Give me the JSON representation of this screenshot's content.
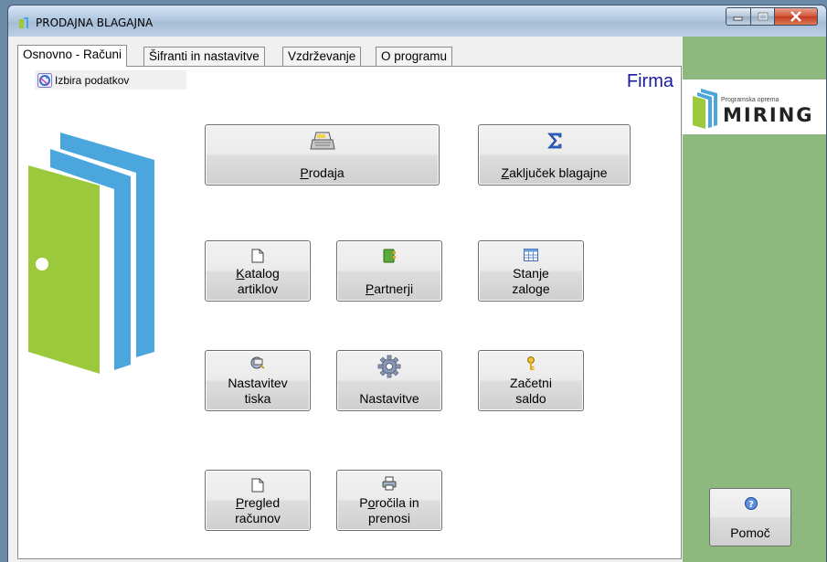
{
  "window": {
    "title": "PRODAJNA BLAGAJNA"
  },
  "tabs": [
    {
      "label": "Osnovno - Računi",
      "active": true
    },
    {
      "label": "Šifranti in nastavitve",
      "active": false
    },
    {
      "label": "Vzdrževanje",
      "active": false
    },
    {
      "label": "O programu",
      "active": false
    }
  ],
  "panel": {
    "izbira_label": "Izbira podatkov",
    "firma_label": "Firma"
  },
  "buttons": {
    "prodaja": {
      "underline": "P",
      "rest": "rodaja",
      "icon": "cash-register-icon"
    },
    "zakljucek": {
      "underline": "Z",
      "rest": "aključek blagajne",
      "icon": "sigma-icon"
    },
    "katalog": {
      "underline": "K",
      "rest": "atalog",
      "line2": "artiklov",
      "icon": "document-icon"
    },
    "partnerji": {
      "underline": "P",
      "rest": "artnerji",
      "icon": "address-book-icon"
    },
    "stanje": {
      "line1": "Stanje",
      "line2": "zaloge",
      "icon": "table-icon"
    },
    "nastavitev_tiska": {
      "line1": "Nastavitev",
      "line2": "tiska",
      "icon": "print-settings-icon"
    },
    "nastavitve": {
      "line1": "Nastavitve",
      "icon": "gear-icon"
    },
    "zacetni": {
      "line1": "Začetni",
      "line2": "saldo",
      "icon": "key-icon"
    },
    "pregled": {
      "underline": "P",
      "rest": "regled",
      "line2": "računov",
      "icon": "document-icon"
    },
    "porocila": {
      "pre": "P",
      "underline": "o",
      "rest": "ročila in",
      "line2": "prenosi",
      "icon": "printer-icon"
    }
  },
  "sidebar": {
    "brand_small": "Programska oprema",
    "brand_big": "MIRING",
    "help_label": "Pomoč",
    "help_icon": "help-icon"
  },
  "colors": {
    "green_panel": "#8db97e",
    "firma_text": "#1a1a9c",
    "door_green": "#9cc83c",
    "door_blue": "#4aa6dc"
  }
}
